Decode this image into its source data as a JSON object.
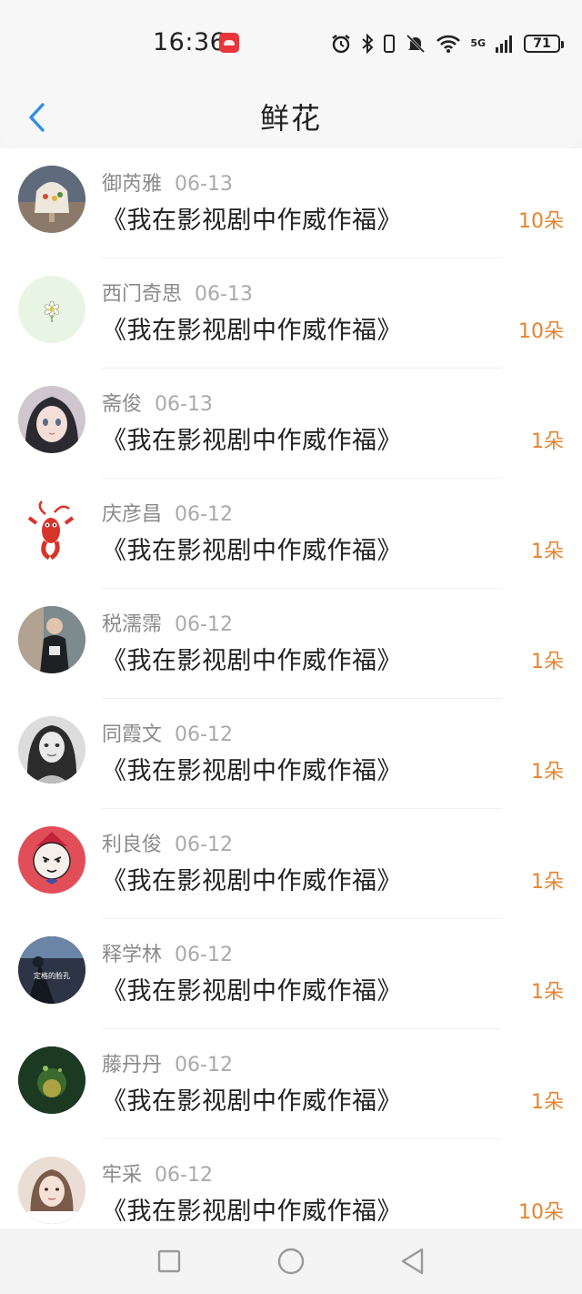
{
  "status_bar": {
    "time": "16:36",
    "network": "5G",
    "battery": "71",
    "icons": [
      "huawei-logo-icon",
      "alarm-icon",
      "bluetooth-icon",
      "vibrate-icon",
      "mute-icon",
      "wifi-icon",
      "signal-icon",
      "battery-icon"
    ]
  },
  "header": {
    "back_icon": "chevron-left-icon",
    "title": "鲜花",
    "accent_color": "#2f8fe6"
  },
  "records": [
    {
      "name": "御芮雅",
      "date": "06-13",
      "book": "《我在影视剧中作威作福》",
      "amount": "10朵",
      "avatar": "bell-photo"
    },
    {
      "name": "西门奇思",
      "date": "06-13",
      "book": "《我在影视剧中作威作福》",
      "amount": "10朵",
      "avatar": "daisy"
    },
    {
      "name": "斋俊",
      "date": "06-13",
      "book": "《我在影视剧中作威作福》",
      "amount": "1朵",
      "avatar": "anime-girl"
    },
    {
      "name": "庆彦昌",
      "date": "06-12",
      "book": "《我在影视剧中作威作福》",
      "amount": "1朵",
      "avatar": "crayfish"
    },
    {
      "name": "税濡霈",
      "date": "06-12",
      "book": "《我在影视剧中作威作福》",
      "amount": "1朵",
      "avatar": "person-photo"
    },
    {
      "name": "同霞文",
      "date": "06-12",
      "book": "《我在影视剧中作威作福》",
      "amount": "1朵",
      "avatar": "bw-portrait"
    },
    {
      "name": "利良俊",
      "date": "06-12",
      "book": "《我在影视剧中作威作福》",
      "amount": "1朵",
      "avatar": "cartoon-girl"
    },
    {
      "name": "释学林",
      "date": "06-12",
      "book": "《我在影视剧中作威作福》",
      "amount": "1朵",
      "avatar": "dark-photo",
      "avatar_text": "定格的脸孔"
    },
    {
      "name": "藤丹丹",
      "date": "06-12",
      "book": "《我在影视剧中作威作福》",
      "amount": "1朵",
      "avatar": "game-scene"
    },
    {
      "name": "牢采",
      "date": "06-12",
      "book": "《我在影视剧中作威作福》",
      "amount": "10朵",
      "avatar": "girl-photo"
    }
  ],
  "colors": {
    "amount": "#e7832f",
    "name": "#8a8a8a",
    "date": "#aaaaaa",
    "book": "#222222"
  },
  "nav_bar": {
    "buttons": [
      "recent-apps-icon",
      "home-icon",
      "back-triangle-icon"
    ]
  }
}
